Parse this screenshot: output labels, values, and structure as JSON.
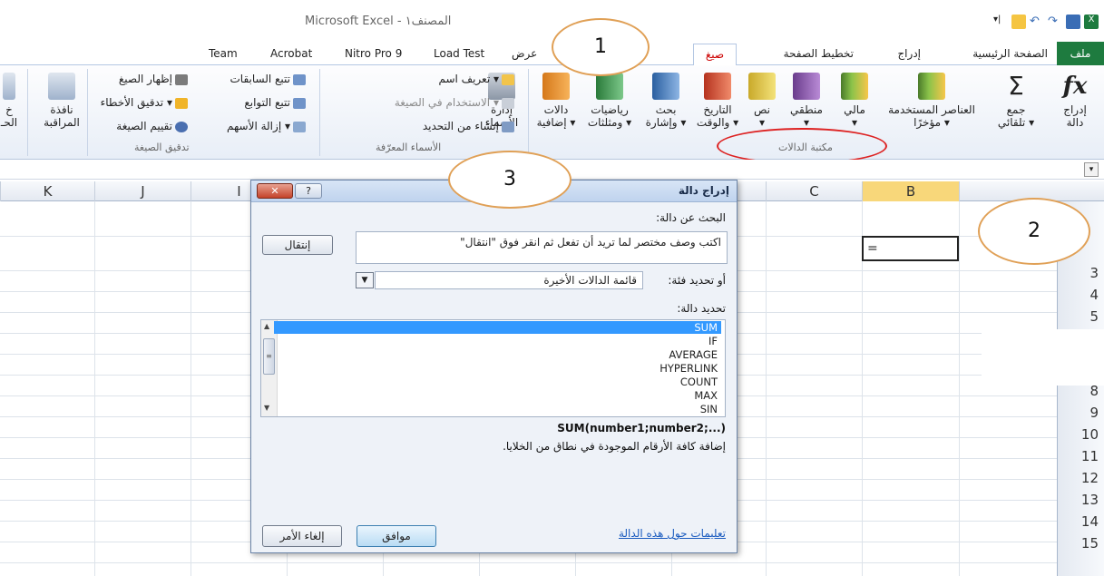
{
  "window": {
    "title": "Microsoft Excel - المصنف١"
  },
  "tabs": {
    "file": "ملف",
    "home": "الصفحة الرئيسية",
    "insert": "إدراج",
    "page_layout": "تخطيط الصفحة",
    "formulas": "صيغ",
    "view": "عرض",
    "load_test": "Load Test",
    "nitro": "Nitro Pro 9",
    "acrobat": "Acrobat",
    "team": "Team"
  },
  "ribbon": {
    "insert_function": "إدراج\nدالة",
    "autosum": "جمع\nتلقائي ▾",
    "recent": "العناصر المستخدمة\nمؤخرًا ▾",
    "financial": "مالي\n▾",
    "logical": "منطقي\n▾",
    "text": "نص\n▾",
    "datetime": "التاريخ\nوالوقت ▾",
    "lookup": "بحث\nوإشارة ▾",
    "math": "رياضيات\nومثلثات ▾",
    "more": "دالات\nإضافية ▾",
    "group_library": "مكتبة الدالات",
    "name_manager": "إدارة\nالأسماء",
    "define_name": "تعريف اسم ▾",
    "use_in_formula": "الاستخدام في الصيغة ▾",
    "create_from_selection": "إنشاء من التحديد",
    "group_names": "الأسماء المعرّفة",
    "trace_precedents": "تتبع السابقات",
    "trace_dependents": "تتبع التوابع",
    "remove_arrows": "إزالة الأسهم ▾",
    "show_formulas": "إظهار الصيغ",
    "error_checking": "تدقيق الأخطاء ▾",
    "evaluate_formula": "تقييم الصيغة",
    "group_auditing": "تدقيق الصيغة",
    "watch_window": "نافذة\nالمراقبة",
    "calc_partial": "خ\nالحـ"
  },
  "grid": {
    "columns": [
      "K",
      "J",
      "I",
      "C",
      "B"
    ],
    "rows": [
      "3",
      "4",
      "5",
      "8",
      "9",
      "10",
      "11",
      "12",
      "13",
      "14",
      "15"
    ],
    "active_cell_value": "="
  },
  "dialog": {
    "title": "إدراج دالة",
    "search_label": "البحث عن دالة:",
    "search_value": "اكتب وصف مختصر لما تريد أن تفعل ثم انقر فوق \"انتقال\"",
    "go_button": "إنتقال",
    "category_label": "أو تحديد فئة:",
    "category_value": "قائمة الدالات الأخيرة",
    "select_label": "تحديد دالة:",
    "functions": [
      "SUM",
      "IF",
      "AVERAGE",
      "HYPERLINK",
      "COUNT",
      "MAX",
      "SIN"
    ],
    "selected_function": "SUM",
    "syntax": "SUM(number1;number2;...)",
    "description": "إضافة كافة الأرقام الموجودة في نطاق من الخلايا.",
    "help_link": "تعليمات حول هذه الدالة",
    "ok_button": "موافق",
    "cancel_button": "إلغاء الأمر"
  },
  "annotations": {
    "c1": "1",
    "c2": "2",
    "c3": "3"
  },
  "colors": {
    "file_tab": "#1e7b3f",
    "selection": "#3399ff",
    "callout_border": "#e0a056",
    "highlight_oval": "#dd2222"
  }
}
